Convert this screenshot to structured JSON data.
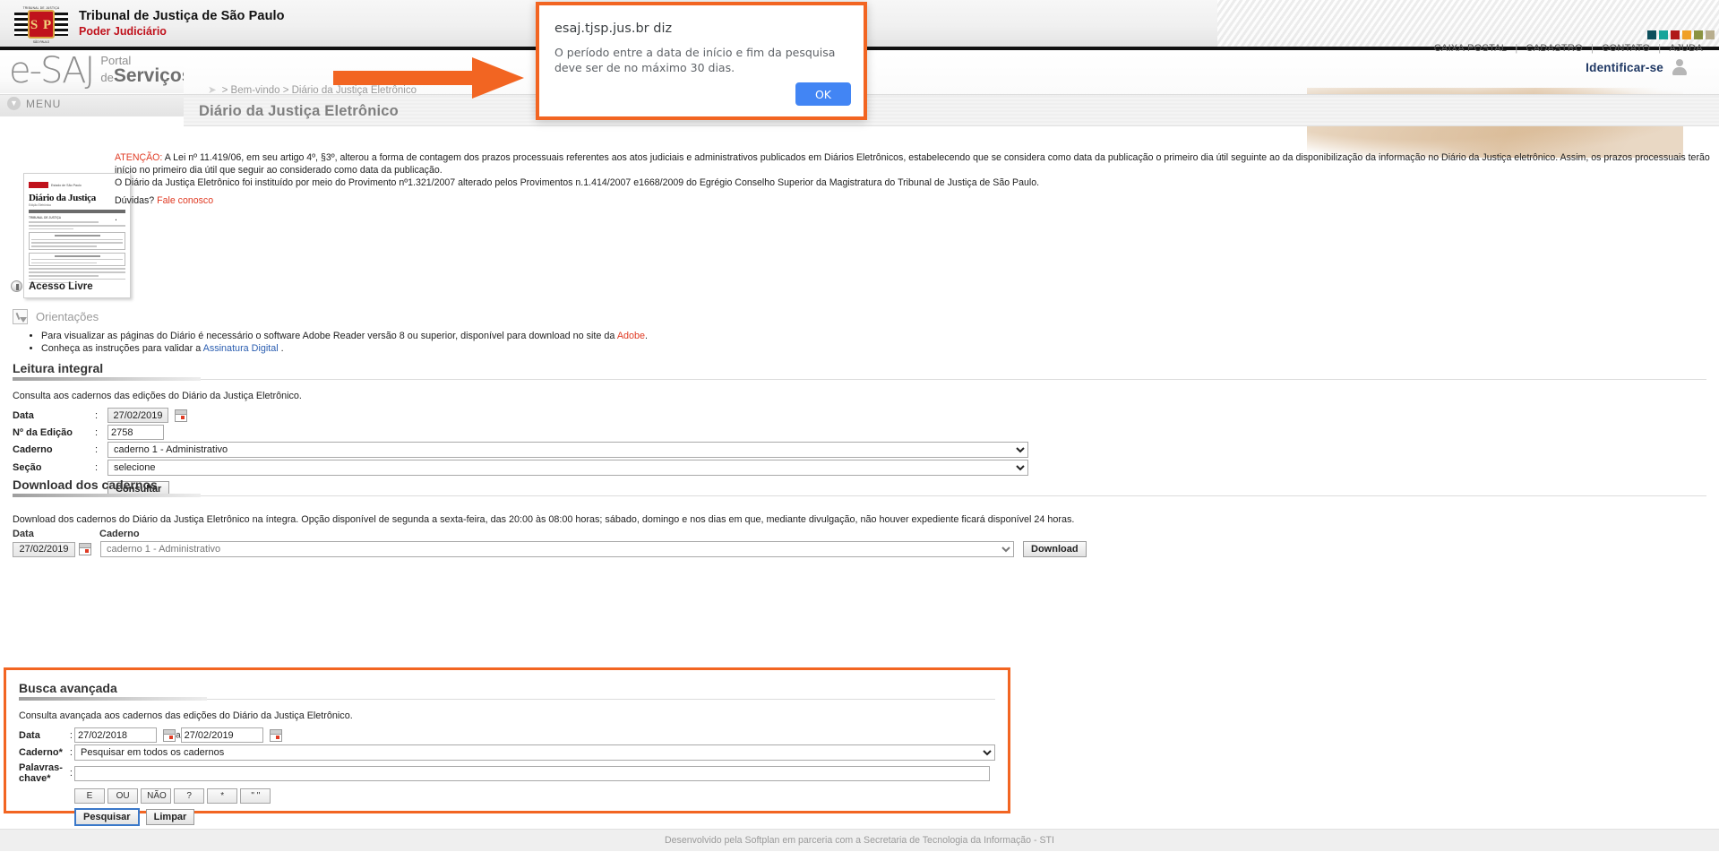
{
  "institutional": {
    "title": "Tribunal de Justiça de São Paulo",
    "subtitle": "Poder Judiciário",
    "logo_letters": "S P",
    "logo_caption_top": "TRIBUNAL DE JUSTIÇA",
    "logo_caption_bottom": "SÃO PAULO",
    "square_colors": [
      "#0d4f5c",
      "#17a59b",
      "#b01a1a",
      "#f0a028",
      "#8a9341",
      "#b8ae8e"
    ]
  },
  "esaj": {
    "brand_e": "e",
    "brand_saj": "-SAJ",
    "brand_portal": "Portal",
    "brand_de": "de",
    "brand_servicos": "Serviços",
    "top_links": [
      "CAIXA POSTAL",
      "CADASTRO",
      "CONTATO",
      "AJUDA"
    ],
    "identificar": "Identificar-se",
    "accent_color": "#f26522"
  },
  "nav": {
    "menu_label": "MENU",
    "breadcrumb": "> Bem-vindo > Diário da Justiça Eletrônico",
    "page_title": "Diário da Justiça Eletrônico"
  },
  "notice": {
    "attention_label": "ATENÇÃO:",
    "attention_text": " A Lei nº 11.419/06, em seu artigo 4º, §3º, alterou a forma de contagem dos prazos processuais referentes aos atos judiciais e administrativos publicados em Diários Eletrônicos, estabelecendo que se considera como data da publicação o primeiro dia útil seguinte ao da disponibilização da informação no Diário da Justiça eletrônico. Assim, os prazos processuais terão início no primeiro dia útil que seguir ao considerado como data da publicação.",
    "provimento_text": "O Diário da Justiça Eletrônico foi instituído por meio do Provimento nº1.321/2007 alterado pelos Provimentos n.1.414/2007 e1668/2009 do Egrégio Conselho Superior da Magistratura do Tribunal de Justiça de São Paulo.",
    "duvidas_label": "Dúvidas? ",
    "duvidas_link": "Fale conosco",
    "dot": "."
  },
  "thumbnail": {
    "state": "Estado de São Paulo",
    "headline": "Diário da Justiça",
    "edition": "Edição Eletrônica",
    "court": "TRIBUNAL DE JUSTIÇA"
  },
  "acesso": {
    "label": "Acesso Livre"
  },
  "orientacoes": {
    "title": "Orientações",
    "items": [
      {
        "pre": "Para visualizar as páginas do Diário é necessário o software Adobe Reader versão 8 ou superior, disponível para download no site da ",
        "link": "Adobe",
        "post": "."
      },
      {
        "pre": "Conheça as instruções para validar a ",
        "link": "Assinatura Digital",
        "post": " ."
      }
    ]
  },
  "leitura": {
    "title": "Leitura integral",
    "description": "Consulta aos cadernos das edições do Diário da Justiça Eletrônico.",
    "fields": {
      "data_label": "Data",
      "data_value": "27/02/2019",
      "edicao_label": "Nº da Edição",
      "edicao_value": "2758",
      "caderno_label": "Caderno",
      "caderno_value": "caderno 1 - Administrativo",
      "secao_label": "Seção",
      "secao_value": "selecione",
      "colon": ":"
    },
    "consultar_button": "Consultar"
  },
  "download": {
    "title": "Download dos cadernos",
    "description": "Download dos cadernos do Diário da Justiça Eletrônico na íntegra. Opção disponível de segunda a sexta-feira, das 20:00 às 08:00 horas; sábado, domingo e nos dias em que, mediante divulgação, não houver expediente ficará disponível 24 horas.",
    "data_label": "Data",
    "data_value": "27/02/2019",
    "caderno_label": "Caderno",
    "caderno_value": "caderno 1 - Administrativo",
    "download_button": "Download"
  },
  "busca": {
    "title": "Busca avançada",
    "description": "Consulta avançada aos cadernos das edições do Diário da Justiça Eletrônico.",
    "data_label": "Data",
    "data_from": "27/02/2018",
    "data_sep": "a",
    "data_to": "27/02/2019",
    "caderno_label": "Caderno*",
    "caderno_value": "Pesquisar em todos os cadernos",
    "palavras_label": "Palavras-chave*",
    "palavras_value": "",
    "colon": ":",
    "operators": [
      "E",
      "OU",
      "NÃO",
      "?",
      "*",
      "\" \""
    ],
    "pesquisar_button": "Pesquisar",
    "limpar_button": "Limpar",
    "highlight_color": "#f26522"
  },
  "footer": {
    "text": "Desenvolvido pela Softplan em parceria com a Secretaria de Tecnologia da Informação - STI"
  },
  "dialog": {
    "title": "esaj.tjsp.jus.br diz",
    "message": "O período entre a data de início e fim da pesquisa deve ser de no máximo 30 dias.",
    "ok_label": "OK",
    "border_color": "#f26522",
    "ok_color": "#4285f4"
  }
}
